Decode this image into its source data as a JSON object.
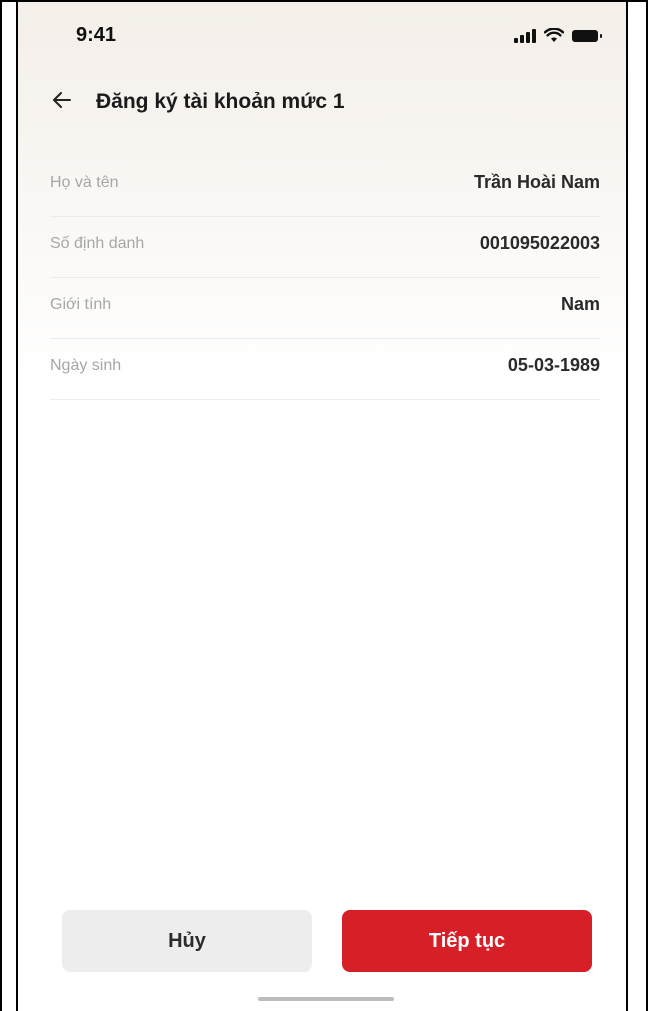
{
  "status_bar": {
    "time": "9:41",
    "icons": [
      "signal-icon",
      "wifi-icon",
      "battery-icon"
    ]
  },
  "header": {
    "back_icon": "arrow-left-icon",
    "title": "Đăng ký tài khoản mức 1"
  },
  "info": {
    "rows": [
      {
        "label": "Họ và tên",
        "value": "Trần Hoài Nam"
      },
      {
        "label": "Số định danh",
        "value": "001095022003"
      },
      {
        "label": "Giới tính",
        "value": "Nam"
      },
      {
        "label": "Ngày sinh",
        "value": "05-03-1989"
      }
    ]
  },
  "actions": {
    "cancel_label": "Hủy",
    "continue_label": "Tiếp tục"
  },
  "colors": {
    "accent": "#d71f27",
    "secondary_button": "#ededed",
    "label_text": "#a6a6a6",
    "value_text": "#2a2a2a"
  }
}
